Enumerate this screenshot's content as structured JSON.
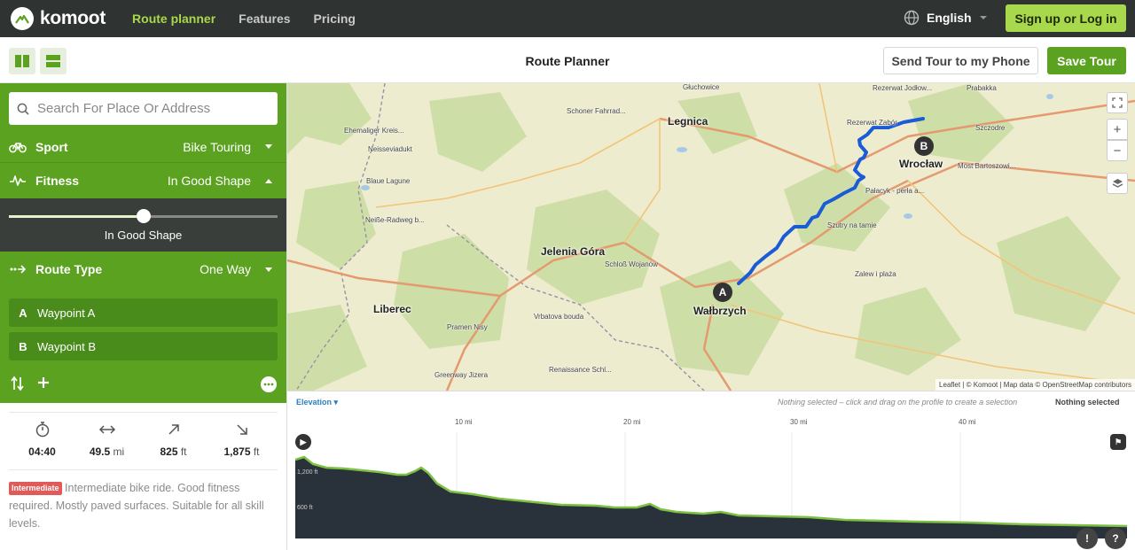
{
  "nav": {
    "logo": "komoot",
    "links": [
      "Route planner",
      "Features",
      "Pricing"
    ],
    "language": "English",
    "signup": "Sign up or Log in"
  },
  "toolbar": {
    "title": "Route Planner",
    "send": "Send Tour to my Phone",
    "save": "Save Tour"
  },
  "sidebar": {
    "search_placeholder": "Search For Place Or Address",
    "sport": {
      "label": "Sport",
      "value": "Bike Touring"
    },
    "fitness": {
      "label": "Fitness",
      "value": "In Good Shape",
      "slider_label": "In Good Shape",
      "slider_level": 0.5
    },
    "route_type": {
      "label": "Route Type",
      "value": "One Way"
    },
    "waypoints": [
      {
        "letter": "A",
        "label": "Waypoint A"
      },
      {
        "letter": "B",
        "label": "Waypoint B"
      }
    ],
    "stats": {
      "duration": "04:40",
      "distance_value": "49.5",
      "distance_unit": "mi",
      "uphill_value": "825",
      "uphill_unit": "ft",
      "downhill_value": "1,875",
      "downhill_unit": "ft"
    },
    "difficulty_badge": "Intermediate",
    "description": "Intermediate bike ride. Good fitness required. Mostly paved surfaces. Suitable for all skill levels."
  },
  "map": {
    "cities": [
      "Legnica",
      "Wrocław",
      "Jelenia Góra",
      "Wałbrzych",
      "Liberec"
    ],
    "pois": [
      "Głuchowice",
      "Schoner Fahrrad...",
      "Ehemaliger Kreis...",
      "Neisseviadukt",
      "Blaue Lagune",
      "Neiße-Radweg b...",
      "Schloß Wojanów",
      "Vrbatova bouda",
      "Pramen Nisy",
      "Greenway Jizera",
      "Renaissance Schl...",
      "Rezerwat Jodłow...",
      "Prabakka",
      "Rezerwat Zabór",
      "Szczodre",
      "Most Bartoszowi...",
      "Pałacyk - perła a...",
      "Szutry na tamie",
      "Zalew i plaża"
    ],
    "marker_a": "A",
    "marker_b": "B",
    "attribution": "Leaflet | © Komoot | Map data © OpenStreetMap contributors"
  },
  "elevation": {
    "title": "Elevation",
    "hint": "Nothing selected – click and drag on the profile to create a selection",
    "selection": "Nothing selected",
    "x_ticks": [
      "10 mi",
      "20 mi",
      "30 mi",
      "40 mi"
    ],
    "y_ticks": [
      "1,200 ft",
      "600 ft"
    ]
  },
  "colors": {
    "brand_green": "#5aa220",
    "nav_bg": "#2f3331",
    "accent_lime": "#a8d84b",
    "route_blue": "#1a5bd6",
    "profile_fill": "#29313a",
    "profile_line": "#7cc142"
  }
}
